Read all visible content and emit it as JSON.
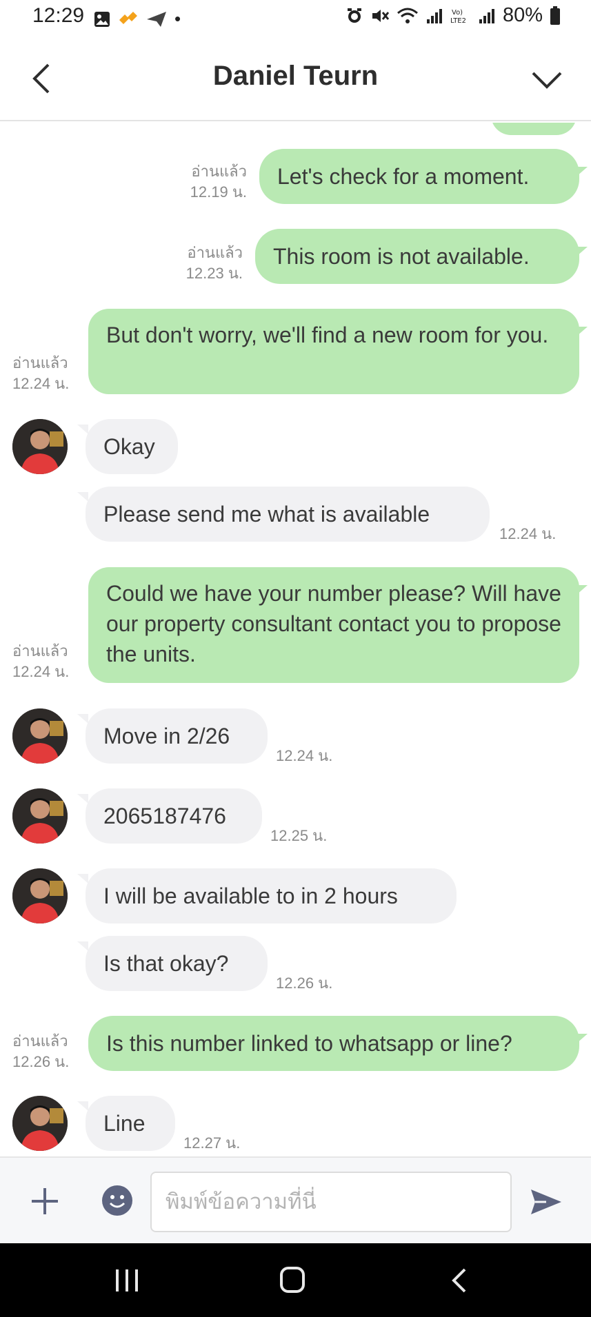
{
  "status_bar": {
    "time": "12:29",
    "battery": "80%",
    "dot": "•"
  },
  "header": {
    "title": "Daniel Teurn"
  },
  "messages": [
    {
      "dir": "out",
      "text": "Let's check for a moment.",
      "read": "อ่านแล้ว",
      "time": "12.19 น."
    },
    {
      "dir": "out",
      "text": "This room is not available.",
      "read": "อ่านแล้ว",
      "time": "12.23 น."
    },
    {
      "dir": "out",
      "text": "But don't worry, we'll find a new room for you.",
      "read": "อ่านแล้ว",
      "time": "12.24 น."
    },
    {
      "dir": "in",
      "text": "Okay",
      "time": ""
    },
    {
      "dir": "in",
      "text": "Please send me what is available",
      "time": "12.24 น."
    },
    {
      "dir": "out",
      "text": "Could we have your number please? Will have our property consultant contact you to propose the units.",
      "read": "อ่านแล้ว",
      "time": "12.24 น."
    },
    {
      "dir": "in",
      "text": "Move in 2/26",
      "time": "12.24 น."
    },
    {
      "dir": "in",
      "text": "2065187476",
      "time": "12.25 น."
    },
    {
      "dir": "in",
      "text": "I will be available to in 2 hours",
      "time": ""
    },
    {
      "dir": "in",
      "text": "Is that okay?",
      "time": "12.26 น."
    },
    {
      "dir": "out",
      "text": "Is this number linked to whatsapp or line?",
      "read": "อ่านแล้ว",
      "time": "12.26 น."
    },
    {
      "dir": "in",
      "text": "Line",
      "time": "12.27 น."
    }
  ],
  "input": {
    "placeholder": "พิมพ์ข้อความที่นี่"
  },
  "colors": {
    "outgoing_bubble": "#b9e9b3",
    "incoming_bubble": "#f1f1f3",
    "send_icon": "#5d6480"
  }
}
